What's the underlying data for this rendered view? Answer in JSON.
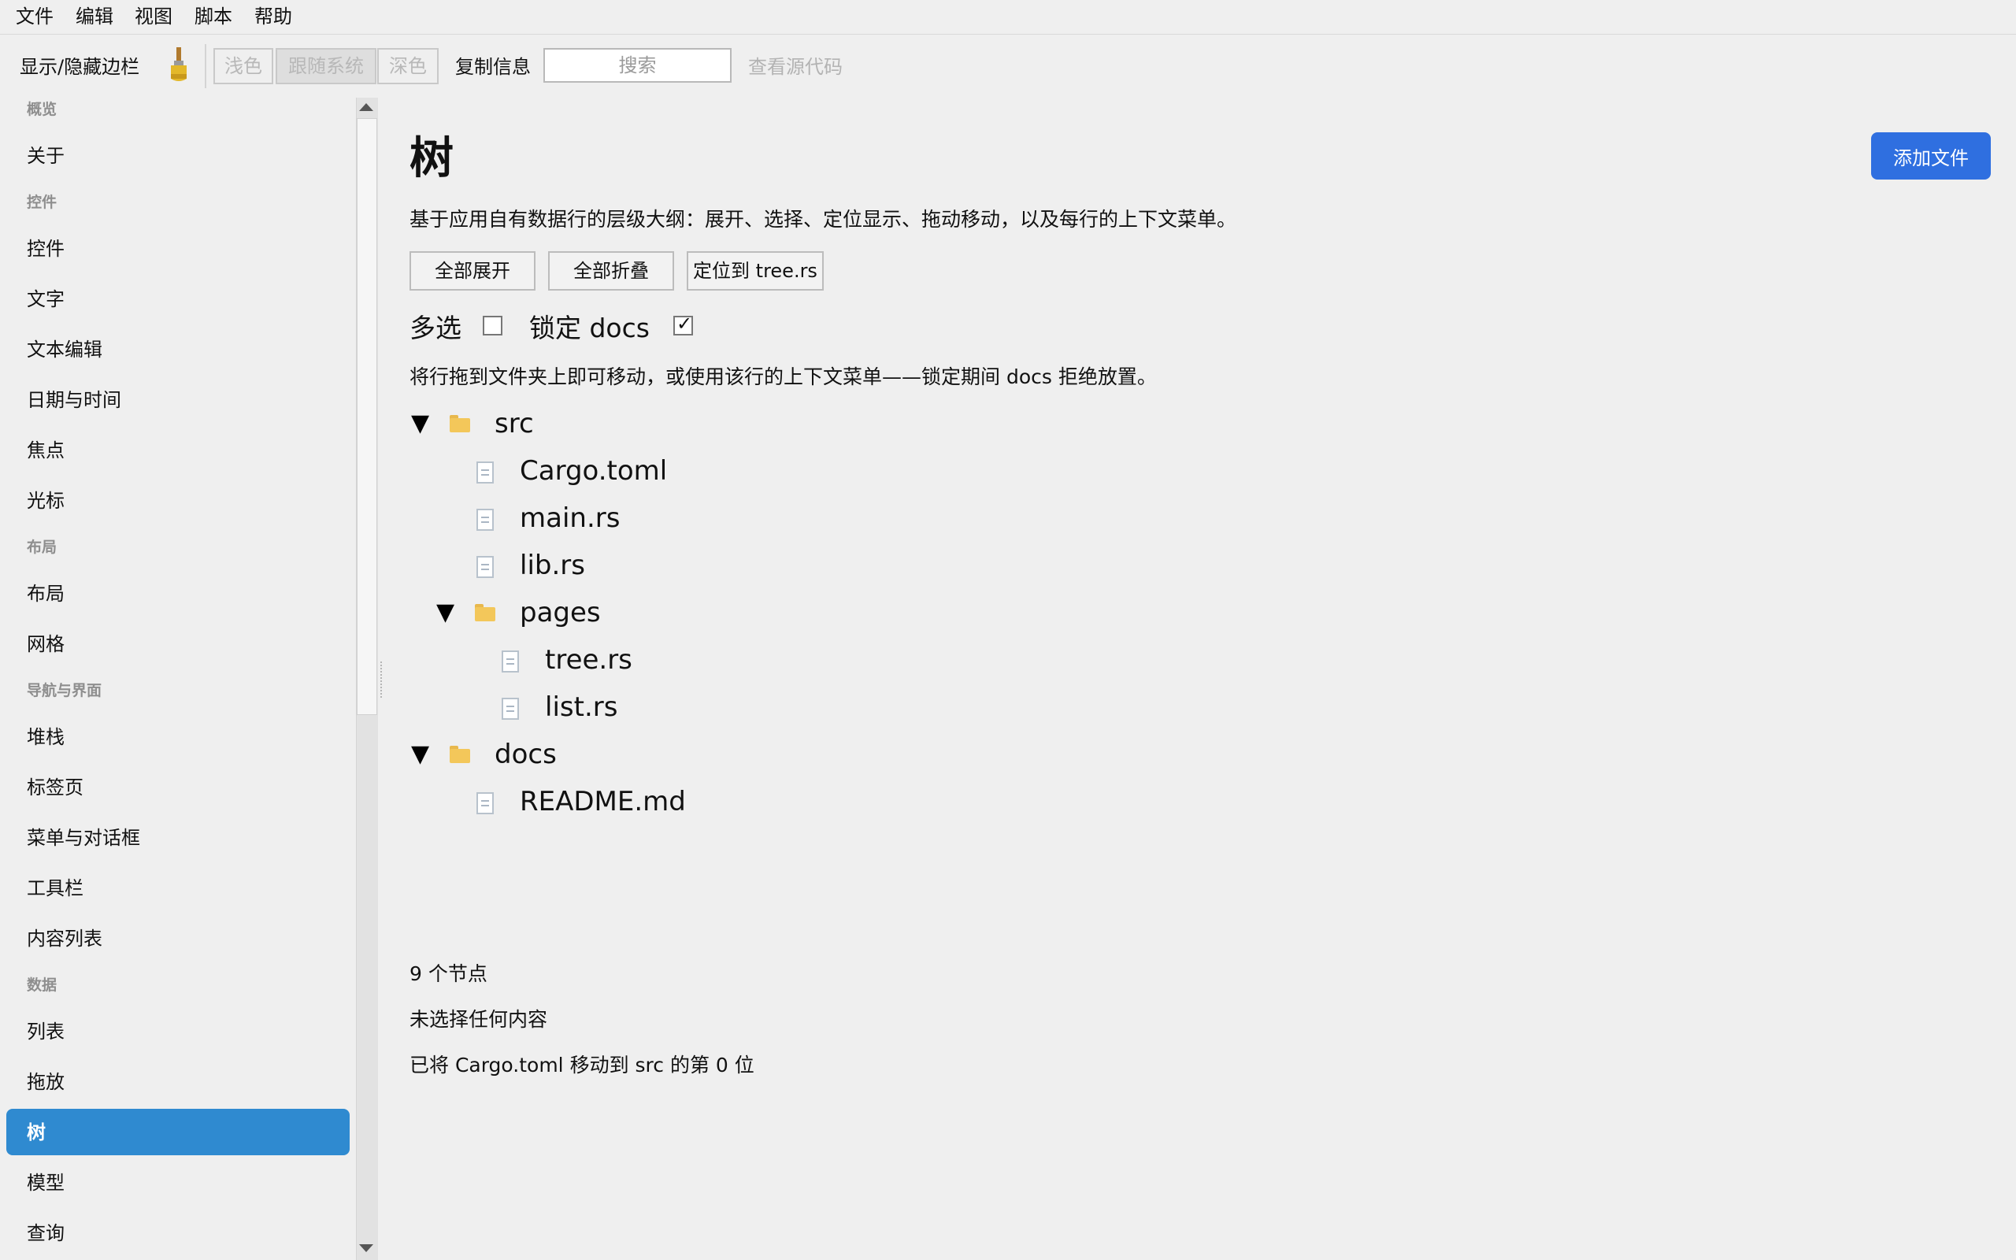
{
  "menubar": {
    "items": [
      "文件",
      "编辑",
      "视图",
      "脚本",
      "帮助"
    ]
  },
  "toolbar": {
    "toggle_sidebar": "显示/隐藏边栏",
    "theme_light": "浅色",
    "theme_system": "跟随系统",
    "theme_dark": "深色",
    "theme_selected": "跟随系统",
    "copy_info": "复制信息",
    "search_placeholder": "搜索",
    "view_source": "查看源代码"
  },
  "sidebar": {
    "sections": [
      {
        "title": "概览",
        "items": [
          "关于"
        ]
      },
      {
        "title": "控件",
        "items": [
          "控件",
          "文字",
          "文本编辑",
          "日期与时间",
          "焦点",
          "光标"
        ]
      },
      {
        "title": "布局",
        "items": [
          "布局",
          "网格"
        ]
      },
      {
        "title": "导航与界面",
        "items": [
          "堆栈",
          "标签页",
          "菜单与对话框",
          "工具栏",
          "内容列表"
        ]
      },
      {
        "title": "数据",
        "items": [
          "列表",
          "拖放",
          "树",
          "模型",
          "查询"
        ]
      }
    ],
    "selected": "树"
  },
  "main": {
    "title": "树",
    "add_file": "添加文件",
    "description": "基于应用自有数据行的层级大纲：展开、选择、定位显示、拖动移动，以及每行的上下文菜单。",
    "buttons": {
      "expand_all": "全部展开",
      "collapse_all": "全部折叠",
      "reveal": "定位到 tree.rs"
    },
    "multi_select": {
      "label": "多选",
      "checked": false
    },
    "lock_docs": {
      "label": "锁定 docs",
      "checked": true,
      "mark": "✓"
    },
    "hint": "将行拖到文件夹上即可移动，或使用该行的上下文菜单——锁定期间 docs 拒绝放置。",
    "tree": [
      {
        "label": "src",
        "type": "folder",
        "expanded": true,
        "depth": 0,
        "twisty": "▼"
      },
      {
        "label": "Cargo.toml",
        "type": "file",
        "depth": 1
      },
      {
        "label": "main.rs",
        "type": "file",
        "depth": 1
      },
      {
        "label": "lib.rs",
        "type": "file",
        "depth": 1
      },
      {
        "label": "pages",
        "type": "folder",
        "expanded": true,
        "depth": 1,
        "twisty": "▼"
      },
      {
        "label": "tree.rs",
        "type": "file",
        "depth": 2
      },
      {
        "label": "list.rs",
        "type": "file",
        "depth": 2
      },
      {
        "label": "docs",
        "type": "folder",
        "expanded": true,
        "depth": 0,
        "twisty": "▼"
      },
      {
        "label": "README.md",
        "type": "file",
        "depth": 1
      }
    ],
    "status": {
      "node_count": "9 个节点",
      "selection": "未选择任何内容",
      "last_action": "已将 Cargo.toml 移动到 src 的第 0 位"
    }
  },
  "colors": {
    "accent": "#2f8ad0",
    "primary_button": "#2f6fe0",
    "folder": "#f3c75a"
  },
  "icons": {
    "brush": "paint-brush-icon",
    "folder": "folder-icon",
    "file": "file-icon",
    "expand": "triangle-down-icon"
  }
}
